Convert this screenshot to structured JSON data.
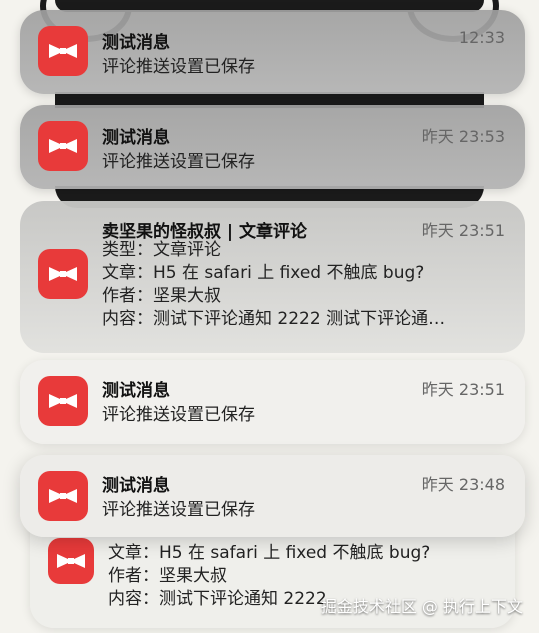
{
  "notifications": [
    {
      "title": "测试消息",
      "body": "评论推送设置已保存",
      "time": "12:33"
    },
    {
      "title": "测试消息",
      "body": "评论推送设置已保存",
      "time": "昨天 23:53"
    },
    {
      "title": "卖坚果的怪叔叔 | 文章评论",
      "time": "昨天 23:51",
      "lines": [
        "类型：文章评论",
        "文章：H5 在 safari 上 fixed 不触底 bug?",
        "作者：坚果大叔",
        "内容：测试下评论通知 2222 测试下评论通…"
      ]
    },
    {
      "title": "测试消息",
      "body": "评论推送设置已保存",
      "time": "昨天 23:51"
    },
    {
      "title": "测试消息",
      "body": "评论推送设置已保存",
      "time": "昨天 23:48"
    }
  ],
  "stacked_behind": {
    "lines": [
      "文章：H5 在 safari 上 fixed 不触底 bug?",
      "作者：坚果大叔",
      "内容：测试下评论通知 2222"
    ]
  },
  "watermark": "掘金技术社区 @ 执行上下文",
  "colors": {
    "app_icon": "#e83a3a"
  },
  "icons": {
    "app": "bow-tie-icon"
  }
}
